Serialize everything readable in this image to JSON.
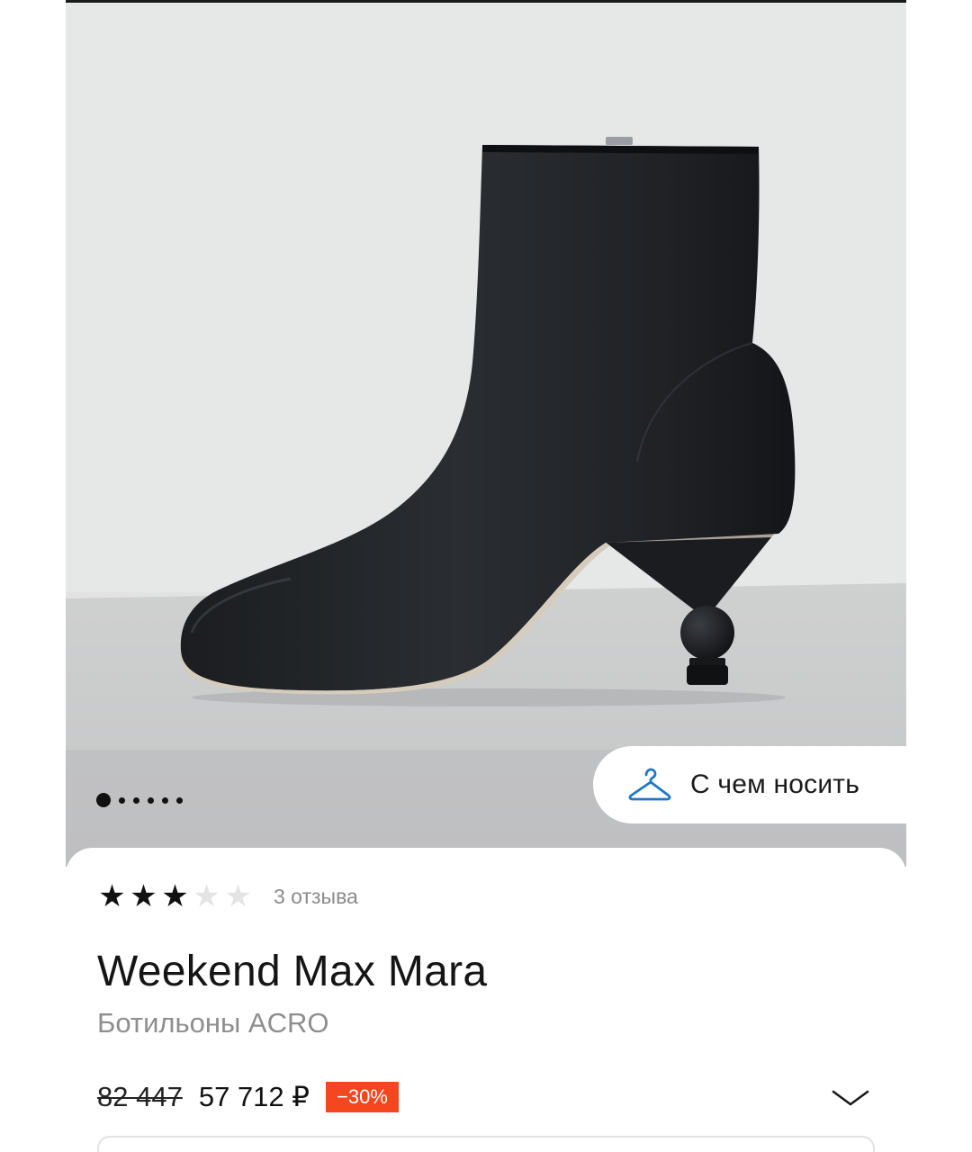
{
  "gallery": {
    "image_alt": "Black leather ankle boot with sculpted ball heel",
    "slide_count": 6,
    "active_slide": 1
  },
  "wear_with": {
    "label": "С чем носить",
    "icon": "hanger-icon"
  },
  "rating": {
    "stars": 3,
    "max_stars": 5,
    "reviews_label": "3 отзыва"
  },
  "product": {
    "brand": "Weekend Max Mara",
    "name": "Ботильоны ACRO"
  },
  "price": {
    "old": "82 447",
    "current": "57 712 ₽",
    "discount": "−30%"
  },
  "colors": {
    "discount_badge": "#f4461f",
    "accent_icon": "#1e78c8",
    "text_muted": "#8e8e8e"
  }
}
